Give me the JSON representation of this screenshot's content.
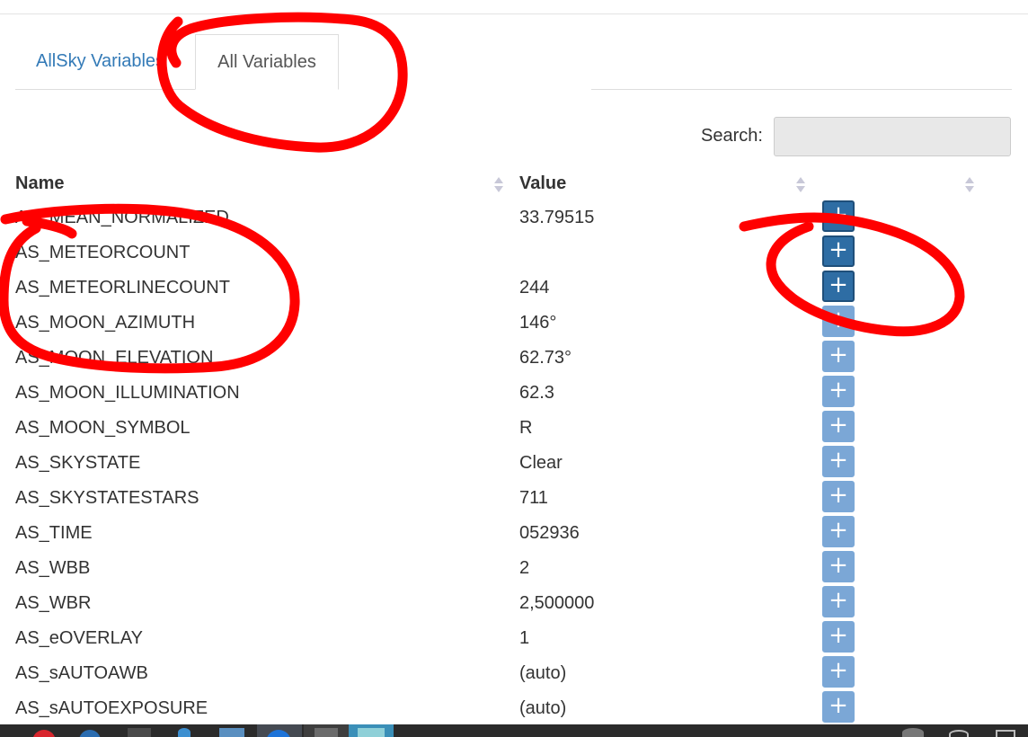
{
  "tabs": [
    {
      "label": "AllSky Variables",
      "active": false
    },
    {
      "label": "All Variables",
      "active": true
    }
  ],
  "search": {
    "label": "Search:",
    "value": ""
  },
  "table": {
    "headers": {
      "name": "Name",
      "value": "Value"
    },
    "rows": [
      {
        "name": "AS_MEAN_NORMALIZED",
        "value": "33.79515",
        "button_style": "dark"
      },
      {
        "name": "AS_METEORCOUNT",
        "value": "",
        "button_style": "dark"
      },
      {
        "name": "AS_METEORLINECOUNT",
        "value": "244",
        "button_style": "dark"
      },
      {
        "name": "AS_MOON_AZIMUTH",
        "value": "146°",
        "button_style": "light"
      },
      {
        "name": "AS_MOON_ELEVATION",
        "value": "62.73°",
        "button_style": "light"
      },
      {
        "name": "AS_MOON_ILLUMINATION",
        "value": "62.3",
        "button_style": "light"
      },
      {
        "name": "AS_MOON_SYMBOL",
        "value": "R",
        "button_style": "light"
      },
      {
        "name": "AS_SKYSTATE",
        "value": "Clear",
        "button_style": "light"
      },
      {
        "name": "AS_SKYSTATESTARS",
        "value": "711",
        "button_style": "light"
      },
      {
        "name": "AS_TIME",
        "value": "052936",
        "button_style": "light"
      },
      {
        "name": "AS_WBB",
        "value": "2",
        "button_style": "light"
      },
      {
        "name": "AS_WBR",
        "value": "2,500000",
        "button_style": "light"
      },
      {
        "name": "AS_eOVERLAY",
        "value": "1",
        "button_style": "light"
      },
      {
        "name": "AS_sAUTOAWB",
        "value": "(auto)",
        "button_style": "light"
      },
      {
        "name": "AS_sAUTOEXPOSURE",
        "value": "(auto)",
        "button_style": "light"
      }
    ],
    "add_button_label": "+"
  },
  "colors": {
    "link": "#337ab7",
    "button_light": "#7ba7d6",
    "button_dark": "#2e6da4",
    "annotation": "#ff0000",
    "taskbar": "#2b2b2b"
  },
  "icons": [
    "sort-both-icon",
    "plus-icon"
  ],
  "annotations": "three hand-drawn red circles around the All Variables tab, the first table names, and the first add buttons"
}
